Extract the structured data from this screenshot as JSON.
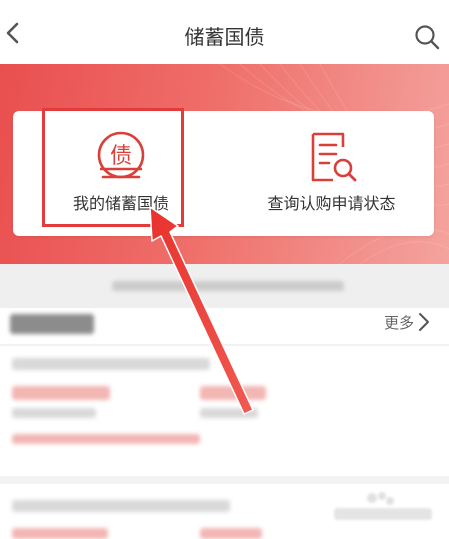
{
  "header": {
    "title": "储蓄国债",
    "back_icon": "chevron-left-icon",
    "search_icon": "search-icon"
  },
  "entries": [
    {
      "label": "我的储蓄国债",
      "icon": "bond-coin-icon",
      "icon_glyph": "债",
      "highlighted": true
    },
    {
      "label": "查询认购申请状态",
      "icon": "document-search-icon"
    }
  ],
  "section": {
    "more_label": "更多"
  },
  "colors": {
    "brand_red": "#d9403a",
    "banner_start": "#e94f4f",
    "banner_end": "#f4a39e",
    "highlight_red": "#e33b3b"
  }
}
